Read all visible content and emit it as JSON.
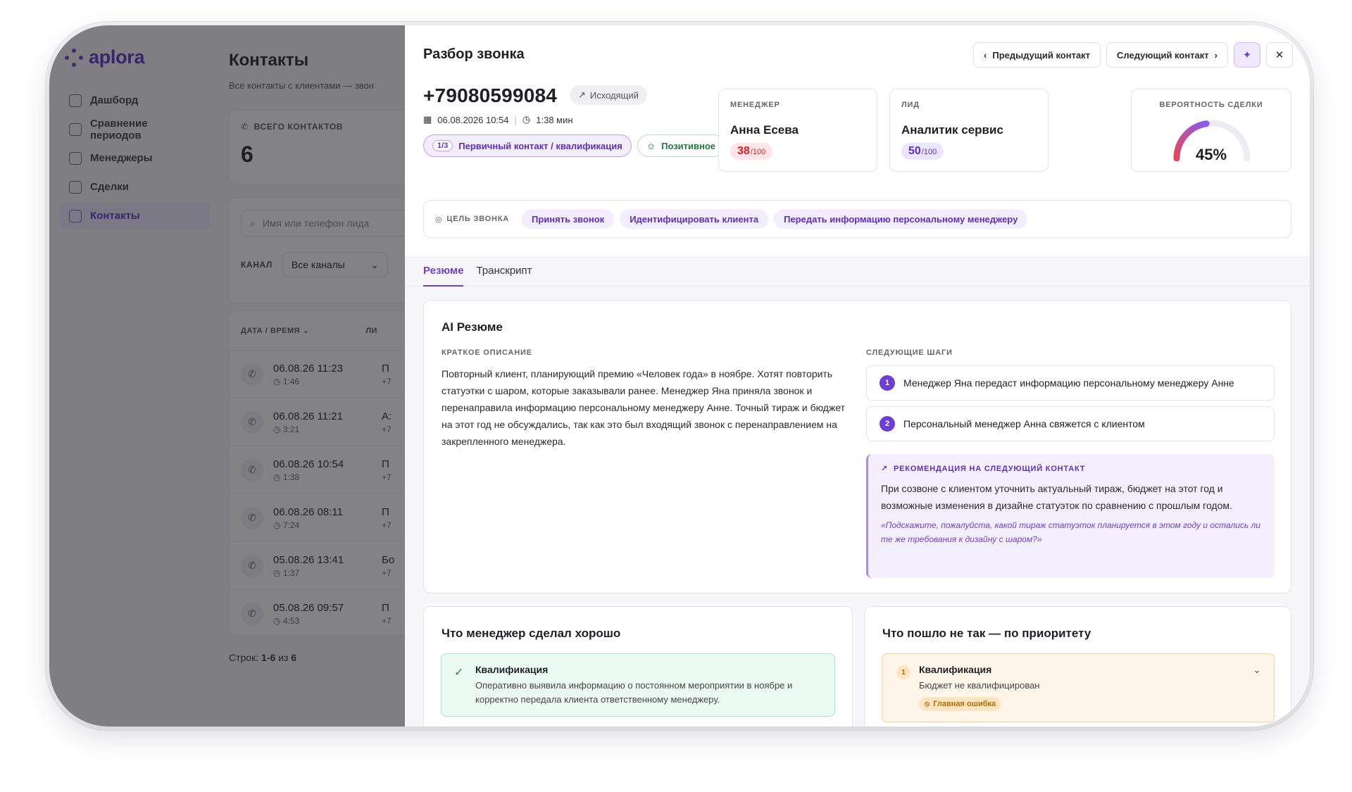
{
  "app": {
    "logo": "aplora",
    "nav": [
      "Дашборд",
      "Сравнение периодов",
      "Менеджеры",
      "Сделки",
      "Контакты"
    ],
    "page_title": "Контакты",
    "page_subtitle": "Все контакты с клиентами — звон",
    "stat_label": "ВСЕГО КОНТАКТОВ",
    "stat_value": "6",
    "search_placeholder": "Имя или телефон лида",
    "channel_label": "КАНАЛ",
    "channel_value": "Все каналы",
    "table_header": "ДАТА / ВРЕМЯ",
    "table_header_partial": "ЛИ",
    "rows": [
      {
        "date": "06.08.26 11:23",
        "dur": "1:46",
        "lead": "П",
        "lead2": "+7"
      },
      {
        "date": "06.08.26 11:21",
        "dur": "3:21",
        "lead": "А:",
        "lead2": "+7"
      },
      {
        "date": "06.08.26 10:54",
        "dur": "1:38",
        "lead": "П",
        "lead2": "+7"
      },
      {
        "date": "06.08.26 08:11",
        "dur": "7:24",
        "lead": "П",
        "lead2": "+7"
      },
      {
        "date": "05.08.26 13:41",
        "dur": "1:37",
        "lead": "Бо",
        "lead2": "+7"
      },
      {
        "date": "05.08.26 09:57",
        "dur": "4:53",
        "lead": "П",
        "lead2": "+7"
      }
    ],
    "rows_label": "Строк:",
    "rows_range": "1-6",
    "rows_of": "из",
    "rows_total": "6"
  },
  "drawer": {
    "title": "Разбор звонка",
    "prev_label": "Предыдущий контакт",
    "next_label": "Следующий контакт",
    "phone": "+79080599084",
    "direction": "Исходящий",
    "datetime": "06.08.2026 10:54",
    "duration": "1:38 мин",
    "stage_count": "1/3",
    "stage_label": "Первичный контакт / квалификация",
    "sentiment": "Позитивное",
    "manager_label": "МЕНЕДЖЕР",
    "manager_name": "Анна Есева",
    "manager_score": "38",
    "score_max": "/100",
    "lead_label": "ЛИД",
    "lead_name": "Аналитик сервис",
    "lead_score": "50",
    "prob_label": "ВЕРОЯТНОСТЬ СДЕЛКИ",
    "prob_value": "45%",
    "prob_fraction": 0.45,
    "goal_label": "ЦЕЛЬ ЗВОНКА",
    "goals": [
      "Принять звонок",
      "Идентифицировать клиента",
      "Передать информацию персональному менеджеру"
    ],
    "tabs": [
      "Резюме",
      "Транскрипт"
    ],
    "summary": {
      "title": "AI Резюме",
      "brief_label": "КРАТКОЕ ОПИСАНИЕ",
      "brief_text": "Повторный клиент, планирующий премию «Человек года» в ноябре. Хотят повторить статуэтки с шаром, которые заказывали ранее. Менеджер Яна приняла звонок и перенаправила информацию персональному менеджеру Анне. Точный тираж и бюджет на этот год не обсуждались, так как это был входящий звонок с перенаправлением на закрепленного менеджера.",
      "next_label": "СЛЕДУЮЩИЕ ШАГИ",
      "steps": [
        "Менеджер Яна передаст информацию персональному менеджеру Анне",
        "Персональный менеджер Анна свяжется с клиентом"
      ],
      "rec_label": "РЕКОМЕНДАЦИЯ НА СЛЕДУЮЩИЙ КОНТАКТ",
      "rec_text": "При созвоне с клиентом уточнить актуальный тираж, бюджет на этот год и возможные изменения в дизайне статуэток по сравнению с прошлым годом.",
      "rec_quote": "«Подскажите, пожалуйста, какой тираж статуэток планируется в этом году и остались ли те же требования к дизайну с шаром?»"
    },
    "good": {
      "title": "Что менеджер сделал хорошо",
      "item_title": "Квалификация",
      "item_text": "Оперативно выявила информацию о постоянном мероприятии в ноябре и корректно передала клиента ответственному менеджеру."
    },
    "bad": {
      "title": "Что пошло не так — по приоритету",
      "item_num": "1",
      "item_title": "Квалификация",
      "item_text": "Бюджет не квалифицирован",
      "badge": "Главная ошибка"
    }
  }
}
